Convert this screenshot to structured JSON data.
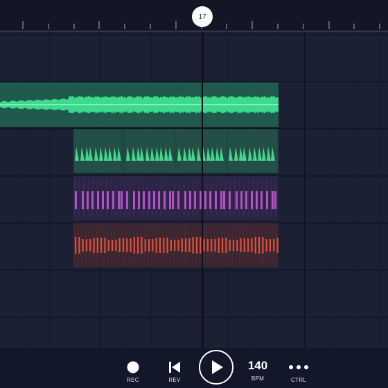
{
  "ruler": {
    "playhead_bar": "17"
  },
  "clips": [
    {
      "name": "audio-waveform-clip",
      "color": "#3ed88e",
      "bg": "#1f5a4c"
    },
    {
      "name": "kick-pattern-clip",
      "color": "#46d68d",
      "bg": "#1f4a44"
    },
    {
      "name": "hat-pattern-clip",
      "color": "#b550c8",
      "bg": "#2b2545"
    },
    {
      "name": "snare-pattern-clip",
      "color": "#e04f38",
      "bg": "#3a2632"
    }
  ],
  "transport": {
    "rec_label": "REC",
    "rev_label": "REV",
    "bpm_value": "140",
    "bpm_label": "BPM",
    "ctrl_label": "CTRL"
  },
  "icons": {
    "rec": "record-icon",
    "rev": "skip-back-icon",
    "play": "play-icon",
    "ctrl": "more-dots-icon"
  }
}
